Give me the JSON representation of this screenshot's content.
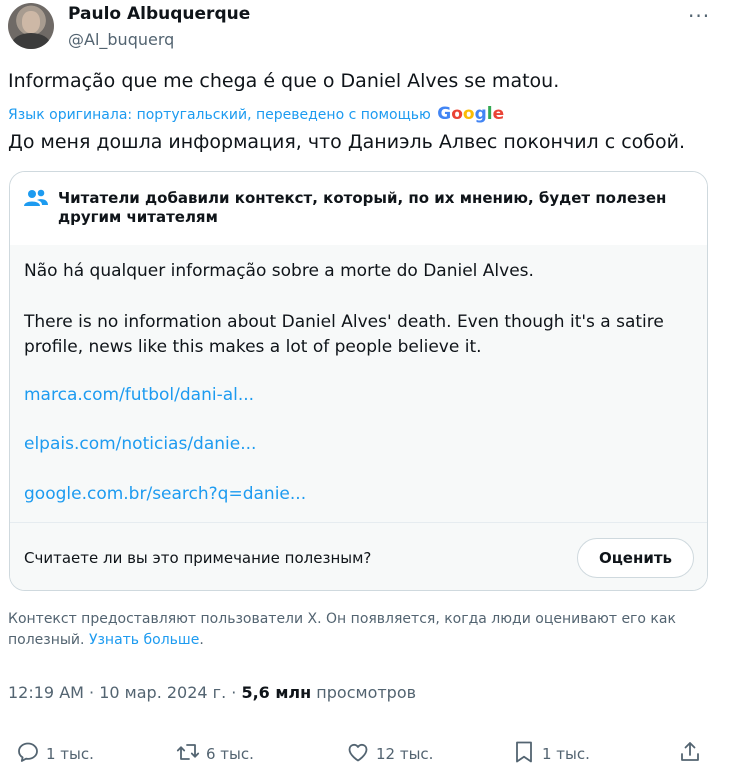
{
  "author": {
    "name": "Paulo Albuquerque",
    "handle": "@Al_buquerq"
  },
  "more_icon": "more-dots-icon",
  "tweet": {
    "text": "Informação que me chega é que o Daniel Alves se matou.",
    "translated_by": "Язык оригинала: португальский, переведено с помощью",
    "google_logo": [
      "G",
      "o",
      "o",
      "g",
      "l",
      "e"
    ],
    "translation": "До меня дошла информация, что Даниэль Алвес покончил с собой."
  },
  "community_note": {
    "icon": "users-icon",
    "title": "Читатели добавили контекст, который, по их мнению, будет полезен другим читателям",
    "text_pt": "Não há qualquer informação sobre a morte do Daniel Alves.",
    "text_en_1": "There is no information about Daniel Alves' death. Even though it's a satire",
    "text_en_2": "profile, news like this makes a lot of people believe it.",
    "links": [
      "marca.com/futbol/dani-al...",
      "elpais.com/noticias/danie...",
      "google.com.br/search?q=danie..."
    ],
    "question": "Считаете ли вы это примечание полезным?",
    "rate_label": "Оценить"
  },
  "disclaimer": {
    "text": "Контекст предоставляют пользователи X. Он появляется, когда люди оценивают его как полезный.",
    "link": "Узнать больше"
  },
  "meta": {
    "time": "12:19 AM",
    "date": "10 мар. 2024 г.",
    "views_count": "5,6 млн",
    "views_label": "просмотров"
  },
  "actions": [
    {
      "icon": "reply-icon",
      "count": "1 тыс."
    },
    {
      "icon": "retweet-icon",
      "count": "6 тыс."
    },
    {
      "icon": "like-icon",
      "count": "12 тыс."
    },
    {
      "icon": "bookmark-icon",
      "count": "1 тыс."
    },
    {
      "icon": "share-icon",
      "count": ""
    }
  ],
  "colors": {
    "link": "#1d9bf0",
    "secondary_text": "#536471",
    "primary_text": "#0f1419",
    "note_background": "#f7f9f9"
  }
}
